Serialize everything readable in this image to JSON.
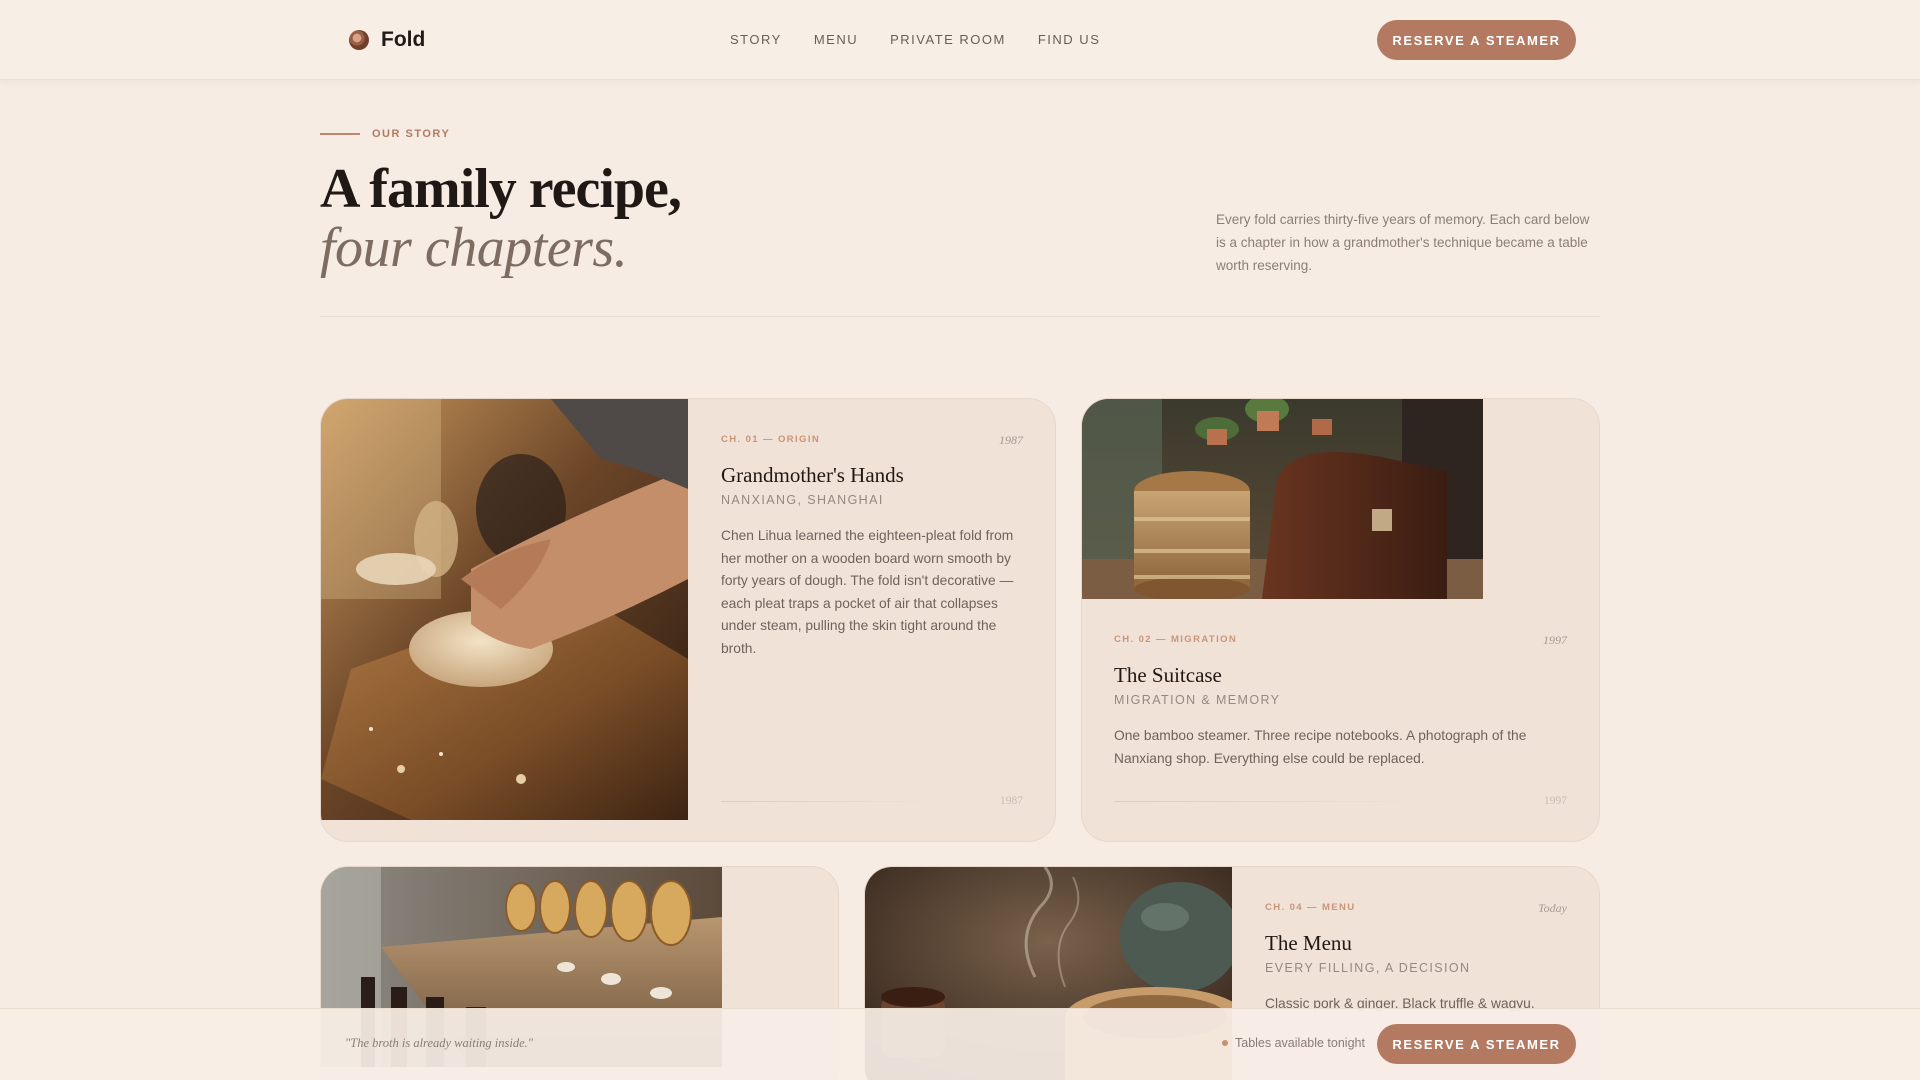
{
  "brand": {
    "name": "Fold",
    "logo_icon": "dumpling-logo-icon"
  },
  "nav": [
    "STORY",
    "MENU",
    "PRIVATE ROOM",
    "FIND US"
  ],
  "header": {
    "cta": "RESERVE A STEAMER"
  },
  "hero": {
    "eyebrow": "OUR STORY",
    "title_line1": "A family recipe,",
    "title_line2": "four chapters.",
    "intro": "Every fold carries thirty-five years of memory. Each card below is a chapter in how a grandmother's technique became a table worth reserving."
  },
  "cards": [
    {
      "chapter": "CH. 01 — ORIGIN",
      "year": "1987",
      "title": "Grandmother's Hands",
      "subtitle": "NANXIANG, SHANGHAI",
      "body": "Chen Lihua learned the eighteen-pleat fold from her mother on a wooden board worn smooth by forty years of dough. The fold isn't decorative — each pleat traps a pocket of air that collapses under steam, pulling the skin tight around the broth.",
      "footer_year": "1987",
      "image": "hands-kneading-dough-photo"
    },
    {
      "chapter": "CH. 02 — MIGRATION",
      "year": "1997",
      "title": "The Suitcase",
      "subtitle": "MIGRATION & MEMORY",
      "body": "One bamboo steamer. Three recipe notebooks. A photograph of the Nanxiang shop. Everything else could be replaced.",
      "footer_year": "1997",
      "image": "steamer-and-suitcase-photo"
    },
    {
      "image": "restaurant-counter-steamers-photo"
    },
    {
      "chapter": "CH. 04 — MENU",
      "year": "Today",
      "title": "The Menu",
      "subtitle": "EVERY FILLING, A DECISION",
      "body": "Classic pork & ginger. Black truffle & wagyu.",
      "image": "tea-and-steamer-photo"
    }
  ],
  "bottom_bar": {
    "quote": "\"The broth is already waiting inside.\"",
    "availability": "Tables available tonight",
    "cta": "RESERVE A STEAMER"
  },
  "colors": {
    "accent": "#b47a61",
    "background": "#f6ece4",
    "card": "#f1e2d8",
    "ink": "#1f1814"
  }
}
